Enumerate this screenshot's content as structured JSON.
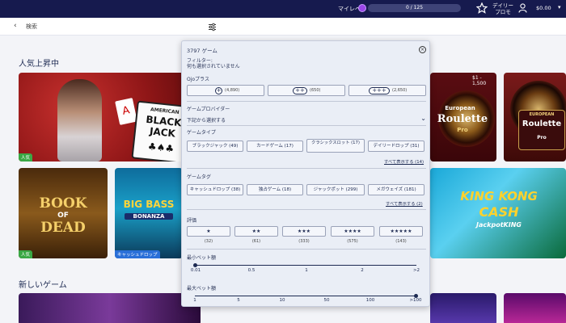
{
  "topbar": {
    "level_label": "マイレベル",
    "level_progress": "0 / 125",
    "level_fraction": 0,
    "daily_line1": "デイリー",
    "daily_line2": "プロモ",
    "balance": "$0.00"
  },
  "search": {
    "placeholder": "検索"
  },
  "sections": {
    "popular": "人気上昇中",
    "new_games": "新しいゲーム"
  },
  "tiles": {
    "blackjack": {
      "line1": "AMERICAN",
      "line2": "BLACK",
      "line3": "JACK",
      "badge": "人気"
    },
    "roulette": {
      "prefix": "European",
      "name": "Roulette",
      "suffix": "Pro"
    },
    "roulette2": {
      "range": "$1 - 1,500",
      "prefix": "EUROPEAN",
      "name": "Roulette",
      "suffix": "Pro"
    },
    "book": {
      "line1": "BOOK",
      "line2": "OF",
      "line3": "DEAD",
      "badge": "人気"
    },
    "bigbass": {
      "line1": "BIG BASS",
      "line2": "BONANZA",
      "badge": "キャッシュドロップ"
    },
    "kingkong": {
      "line1": "KING KONG",
      "line2": "CASH",
      "line3": "JackpotKING"
    }
  },
  "filter_panel": {
    "game_count": "3797 ゲーム",
    "filter_label": "フィルター:",
    "filter_none": "何も選択されていません",
    "ojo_plus_label": "Ojoプラス",
    "ojo_plus": [
      {
        "icons": "+",
        "count": "(4,890)"
      },
      {
        "icons": "++",
        "count": "(650)"
      },
      {
        "icons": "+++",
        "count": "(2,650)"
      }
    ],
    "provider_label": "ゲームプロバイダー",
    "provider_select": "下記から選択する",
    "game_type_label": "ゲームタイプ",
    "game_types": [
      {
        "label": "ブラックジャック (49)"
      },
      {
        "label": "カードゲーム (17)"
      },
      {
        "label": "クラシックスロット (17)"
      },
      {
        "label": "デイリードロップ (31)"
      }
    ],
    "show_all_types": "すべて表示する (14)",
    "game_tag_label": "ゲームタグ",
    "game_tags": [
      {
        "label": "キャッシュドロップ (38)"
      },
      {
        "label": "独占ゲーム (18)"
      },
      {
        "label": "ジャックポット (299)"
      },
      {
        "label": "メガウェイズ (181)"
      }
    ],
    "show_all_tags": "すべて表示する (2)",
    "rating_label": "評価",
    "ratings": [
      {
        "stars": "★",
        "count": "(32)"
      },
      {
        "stars": "★★",
        "count": "(61)"
      },
      {
        "stars": "★★★",
        "count": "(333)"
      },
      {
        "stars": "★★★★",
        "count": "(575)"
      },
      {
        "stars": "★★★★★",
        "count": "(143)"
      }
    ],
    "min_bet_label": "最小ベット額",
    "min_bet_ticks": [
      "0.01",
      "0.5",
      "1",
      "2",
      ">2"
    ],
    "max_bet_label": "最大ベット額",
    "max_bet_ticks": [
      "1",
      "5",
      "10",
      "50",
      "100",
      ">100"
    ]
  },
  "colors": {
    "topbar": "#161a4e",
    "accent": "#1d2a52",
    "badge_green": "#3aa845",
    "badge_blue": "#2a6fd8"
  }
}
